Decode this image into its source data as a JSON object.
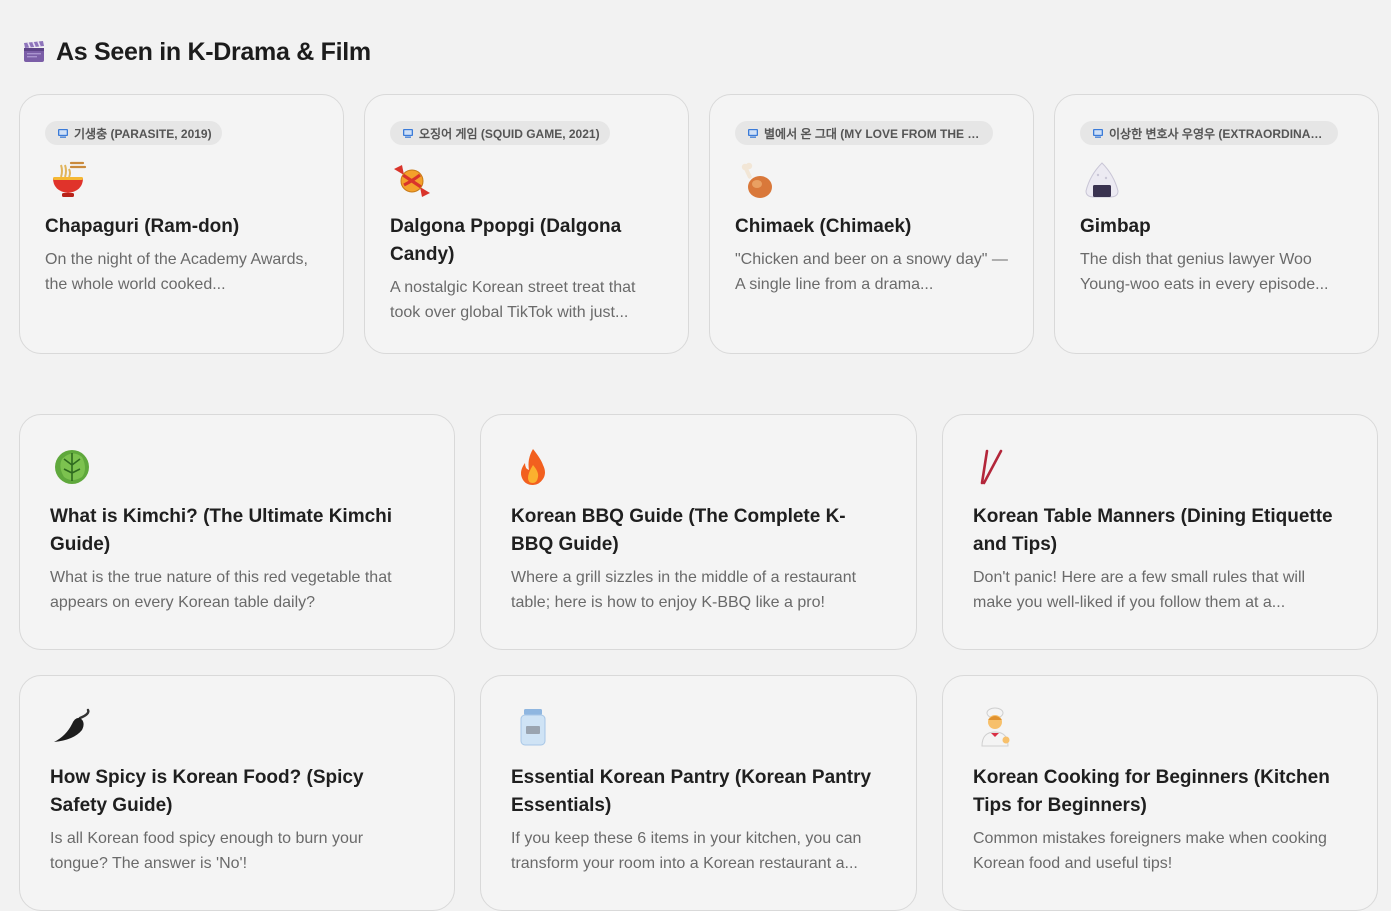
{
  "drama_section": {
    "title": "As Seen in K-Drama & Film",
    "icon": "clapperboard-icon",
    "cards": [
      {
        "tag": "기생충 (PARASITE, 2019)",
        "emoji": "ramen-bowl-icon",
        "title": "Chapaguri (Ram-don)",
        "desc": "On the night of the Academy Awards, the whole world cooked..."
      },
      {
        "tag": "오징어 게임 (SQUID GAME, 2021)",
        "emoji": "candy-icon",
        "title": "Dalgona Ppopgi (Dalgona Candy)",
        "desc": "A nostalgic Korean street treat that took over global TikTok with just..."
      },
      {
        "tag": "별에서 온 그대 (MY LOVE FROM THE S...",
        "emoji": "chicken-leg-icon",
        "title": "Chimaek (Chimaek)",
        "desc": "\"Chicken and beer on a snowy day\" — A single line from a drama..."
      },
      {
        "tag": "이상한 변호사 우영우 (EXTRAORDINAR...",
        "emoji": "rice-ball-icon",
        "title": "Gimbap",
        "desc": "The dish that genius lawyer Woo Young-woo eats in every episode..."
      }
    ]
  },
  "guides": [
    {
      "emoji": "cabbage-icon",
      "title": "What is Kimchi? (The Ultimate Kimchi Guide)",
      "desc": "What is the true nature of this red vegetable that appears on every Korean table daily?"
    },
    {
      "emoji": "fire-icon",
      "title": "Korean BBQ Guide (The Complete K-BBQ Guide)",
      "desc": "Where a grill sizzles in the middle of a restaurant table; here is how to enjoy K-BBQ like a pro!"
    },
    {
      "emoji": "chopsticks-icon",
      "title": "Korean Table Manners (Dining Etiquette and Tips)",
      "desc": "Don't panic! Here are a few small rules that will make you well-liked if you follow them at a..."
    },
    {
      "emoji": "hot-pepper-icon",
      "title": "How Spicy is Korean Food? (Spicy Safety Guide)",
      "desc": "Is all Korean food spicy enough to burn your tongue? The answer is 'No'!"
    },
    {
      "emoji": "jar-icon",
      "title": "Essential Korean Pantry (Korean Pantry Essentials)",
      "desc": "If you keep these 6 items in your kitchen, you can transform your room into a Korean restaurant a..."
    },
    {
      "emoji": "cook-icon",
      "title": "Korean Cooking for Beginners (Kitchen Tips for Beginners)",
      "desc": "Common mistakes foreigners make when cooking Korean food and useful tips!"
    }
  ]
}
